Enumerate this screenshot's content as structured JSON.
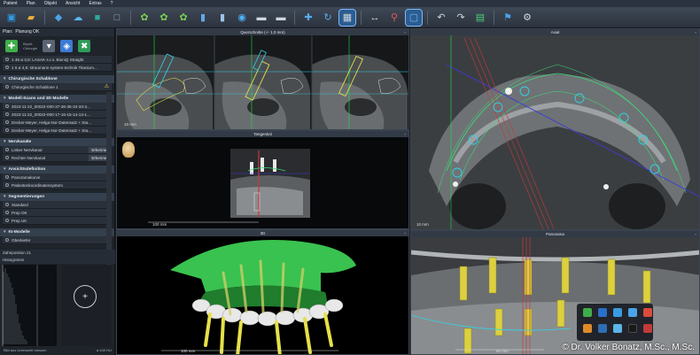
{
  "menu": [
    "Patient",
    "Plan",
    "Objekt",
    "Ansicht",
    "Extras",
    "?"
  ],
  "toolbar_icons": [
    {
      "name": "new-patient-icon",
      "glyph": "▣",
      "color": "#2e9be6"
    },
    {
      "name": "open-folder-icon",
      "glyph": "▰",
      "color": "#e8b23b"
    },
    {
      "name": "sep"
    },
    {
      "name": "import-scan-icon",
      "glyph": "◆",
      "color": "#4aa3e8"
    },
    {
      "name": "cloud-icon",
      "glyph": "☁",
      "color": "#58b6f0"
    },
    {
      "name": "cube-icon",
      "glyph": "■",
      "color": "#2fa89a"
    },
    {
      "name": "cube-outline-icon",
      "glyph": "□",
      "color": "#9fb0c2"
    },
    {
      "name": "sep"
    },
    {
      "name": "teeth-select-icon",
      "glyph": "✿",
      "color": "#7bcf52"
    },
    {
      "name": "implant-add-icon",
      "glyph": "✿",
      "color": "#7bcf52"
    },
    {
      "name": "implant-edit-icon",
      "glyph": "✿",
      "color": "#7bcf52"
    },
    {
      "name": "sleeve-icon",
      "glyph": "▮",
      "color": "#62a8e4"
    },
    {
      "name": "abutment-icon",
      "glyph": "▮",
      "color": "#9fc3e6"
    },
    {
      "name": "nerve-icon",
      "glyph": "◉",
      "color": "#4db3ff"
    },
    {
      "name": "pin-icon",
      "glyph": "▬",
      "color": "#cfd6de"
    },
    {
      "name": "guide-icon",
      "glyph": "▬",
      "color": "#cfd6de"
    },
    {
      "name": "sep"
    },
    {
      "name": "move-icon",
      "glyph": "✚",
      "color": "#5aa9ec"
    },
    {
      "name": "rotate-icon",
      "glyph": "↻",
      "color": "#5aa9ec"
    },
    {
      "name": "grid-icon",
      "glyph": "▦",
      "color": "#cfd6de",
      "active": true
    },
    {
      "name": "sep"
    },
    {
      "name": "measure-icon",
      "glyph": "↔",
      "color": "#cfd6de"
    },
    {
      "name": "marker-icon",
      "glyph": "⚲",
      "color": "#e05a5a"
    },
    {
      "name": "zoom-icon",
      "glyph": "▢",
      "color": "#6ab8ff",
      "active": true
    },
    {
      "name": "sep"
    },
    {
      "name": "undo-icon",
      "glyph": "↶",
      "color": "#cfd6de"
    },
    {
      "name": "redo-icon",
      "glyph": "↷",
      "color": "#cfd6de"
    },
    {
      "name": "export-icon",
      "glyph": "▤",
      "color": "#4ad07a"
    },
    {
      "name": "sep"
    },
    {
      "name": "flag-icon",
      "glyph": "⚑",
      "color": "#4aa3e8"
    },
    {
      "name": "settings-icon",
      "glyph": "⚙",
      "color": "#cfd6de"
    }
  ],
  "left": {
    "plan_label": "Plan:",
    "plan_name": "Planung OK",
    "plan_sub1": "Bkpkt:",
    "plan_sub2": "Chirurgie",
    "implants": [
      {
        "text": "1  48  ø 3,8:  LASAK s.r.o. BioniQ Straight"
      },
      {
        "text": "1  6  ø 4,5:  straumann system-technik Titanium..."
      }
    ],
    "sections": [
      {
        "title": "Chirurgische Schablone",
        "items": [
          {
            "text": "Chirurgische Schablone 1",
            "warn": "⚠"
          }
        ]
      },
      {
        "title": "Modell-Scans und 3D Modelle",
        "items": [
          {
            "text": "2023-11-22_00022-000-37-36-35-34-33-3..."
          },
          {
            "text": "2023-11-22_00022-000-17-16-15-14-13-1..."
          },
          {
            "text": "Decker-Meyer, Helga Nor-Datensatz + Sta..."
          },
          {
            "text": "Decker-Meyer, Helga Nor-Datensatz + Sta..."
          }
        ]
      },
      {
        "title": "Nervkanäle",
        "items": [
          {
            "text": "Linker Nervkanal",
            "tag": "Erkennen"
          },
          {
            "text": "Rechter Nervkanal",
            "tag": "Erkennen"
          }
        ]
      },
      {
        "title": "Ansichtsdefinition",
        "items": [
          {
            "text": "Panoramakurve"
          },
          {
            "text": "Patientenkoordinatensystem"
          }
        ]
      },
      {
        "title": "Segmentierungen",
        "items": [
          {
            "text": "Standard"
          },
          {
            "text": "Prep OK"
          },
          {
            "text": "Prep UK"
          }
        ]
      },
      {
        "title": "KI-Modelle",
        "items": [
          {
            "text": "Oberkiefer"
          }
        ]
      }
    ],
    "zahnposition": "Zahnposition 21",
    "histogram_label": "Histogramm",
    "histogram_foot_left": "Bild aus Untersicht messen",
    "histogram_foot_right": "ø 440 HU",
    "histogram_plus": "+"
  },
  "viewports": {
    "querschnitte": {
      "title": "Querschnitte (-/- 1,0 mm)",
      "scale": "10 mm"
    },
    "axial": {
      "title": "Axial",
      "scale": "10 mm"
    },
    "tangential": {
      "title": "Tangential",
      "scale": "100 mm"
    },
    "3d": {
      "title": "3D",
      "scale": "100 mm"
    },
    "panorama": {
      "title": "Panorama",
      "scale": "50 mm"
    }
  },
  "copyright": "© Dr. Volker Bonatz, M.Sc., M.Sc.",
  "colors": {
    "accent": "#4aa3e8",
    "implant": "#e6e04a",
    "guide": "#3be07a",
    "nerve": "#2fd5e8"
  }
}
